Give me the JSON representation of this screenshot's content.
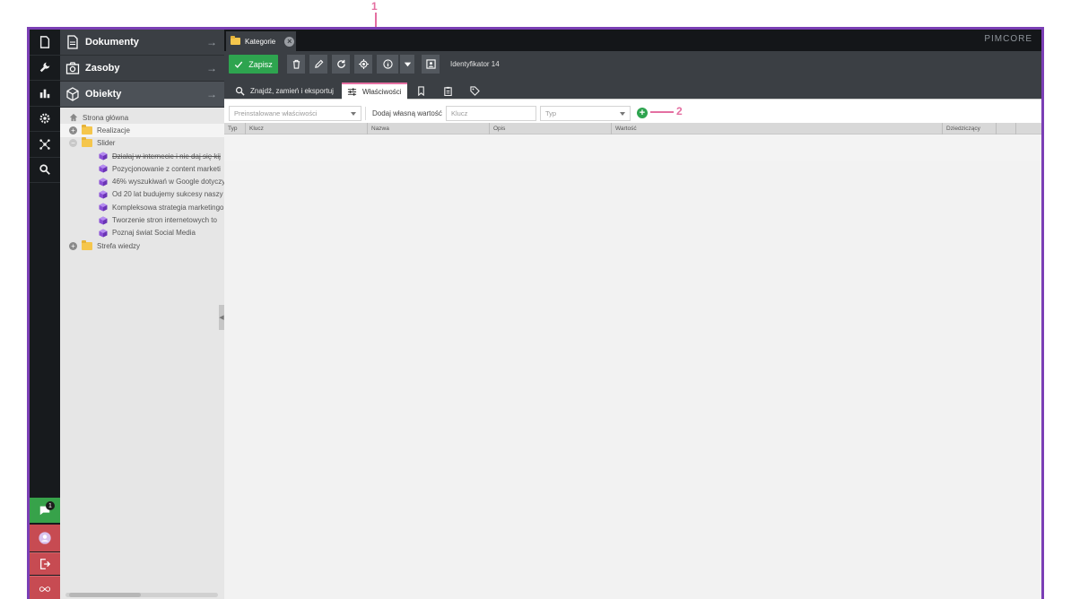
{
  "sidebar_icons": [
    "document-icon",
    "wrench-icon",
    "chart-icon",
    "gear-icon",
    "network-icon",
    "search-icon"
  ],
  "bottom": {
    "notification_count": "1"
  },
  "accordion": {
    "documents": "Dokumenty",
    "assets": "Zasoby",
    "objects": "Obiekty"
  },
  "tree": {
    "root": "Strona główna",
    "items": [
      {
        "label": "Realizacje",
        "type": "folder",
        "expander": "plus",
        "level": 1
      },
      {
        "label": "Slider",
        "type": "folder",
        "expander": "minus",
        "level": 1
      },
      {
        "label": "Działaj w internecie i nie daj się kij",
        "type": "object",
        "level": 2,
        "strike": true
      },
      {
        "label": "Pozycjonowanie z content marketi",
        "type": "object",
        "level": 2
      },
      {
        "label": "46% wyszukiwań w Google dotyczy",
        "type": "object",
        "level": 2
      },
      {
        "label": "Od 20 lat budujemy sukcesy naszy",
        "type": "object",
        "level": 2
      },
      {
        "label": "Kompleksowa strategia marketingo",
        "type": "object",
        "level": 2
      },
      {
        "label": "Tworzenie stron internetowych to",
        "type": "object",
        "level": 2
      },
      {
        "label": "Poznaj świat Social Media",
        "type": "object",
        "level": 2
      },
      {
        "label": "Strefa wiedzy",
        "type": "folder",
        "expander": "plus",
        "level": 1
      }
    ]
  },
  "doc_tab": {
    "label": "Kategorie"
  },
  "brand": "PIMCORE",
  "toolbar": {
    "save_label": "Zapisz",
    "identifier": "Identyfikator 14"
  },
  "subtabs": {
    "search": "Znajdź, zamień i eksportuj",
    "properties": "Właściwości"
  },
  "filters": {
    "predefined_placeholder": "Preinstalowane właściwości",
    "add_own_label": "Dodaj własną wartość",
    "key_placeholder": "Klucz",
    "type_placeholder": "Typ"
  },
  "grid": {
    "columns": [
      "Typ",
      "Klucz",
      "Nazwa",
      "Opis",
      "Wartość",
      "Dziedziczący"
    ]
  },
  "annotations": {
    "one": "1",
    "two": "2"
  },
  "colors": {
    "accent": "#e46fa1",
    "save": "#2ea44f",
    "frame": "#7b3fb5",
    "sidebar": "#171a1d",
    "logout": "#c74b52"
  }
}
